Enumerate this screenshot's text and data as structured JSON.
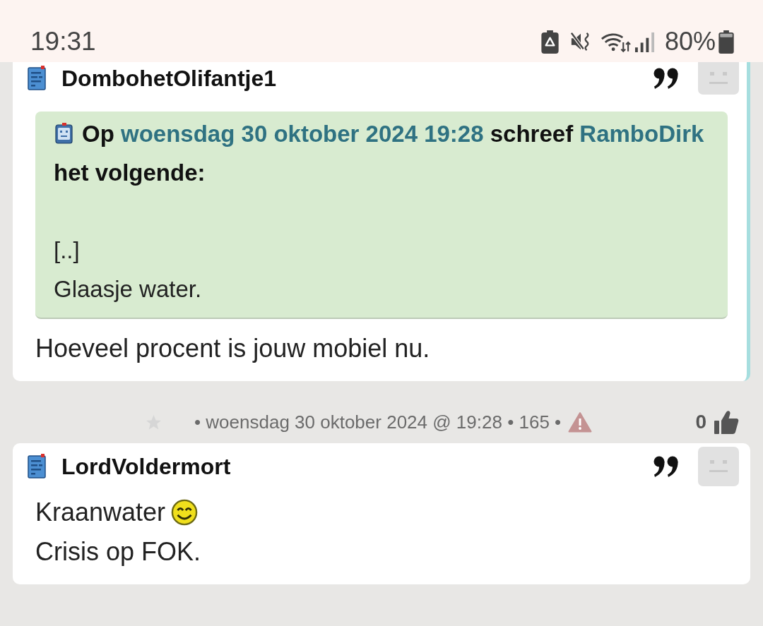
{
  "status_bar": {
    "time": "19:31",
    "battery": "80%"
  },
  "posts": [
    {
      "author": "DombohetOlifantje1",
      "highlighted": true,
      "quote": {
        "lead": "Op",
        "date": "woensdag 30 oktober 2024 19:28",
        "verb": "schreef",
        "author": "RamboDirk",
        "tail": "het volgende:",
        "lines": [
          "[..]",
          "Glaasje water."
        ]
      },
      "body": [
        {
          "text": "Hoeveel procent is jouw mobiel nu.",
          "smiley": false
        }
      ],
      "footer": {
        "starred": false,
        "info": "• woensdag 30 oktober 2024 @ 19:28 • 165 •",
        "likes": "0"
      }
    },
    {
      "author": "LordVoldermort",
      "highlighted": false,
      "body": [
        {
          "text": "Kraanwater",
          "smiley": true
        },
        {
          "text": "Crisis op FOK.",
          "smiley": false
        }
      ]
    }
  ]
}
